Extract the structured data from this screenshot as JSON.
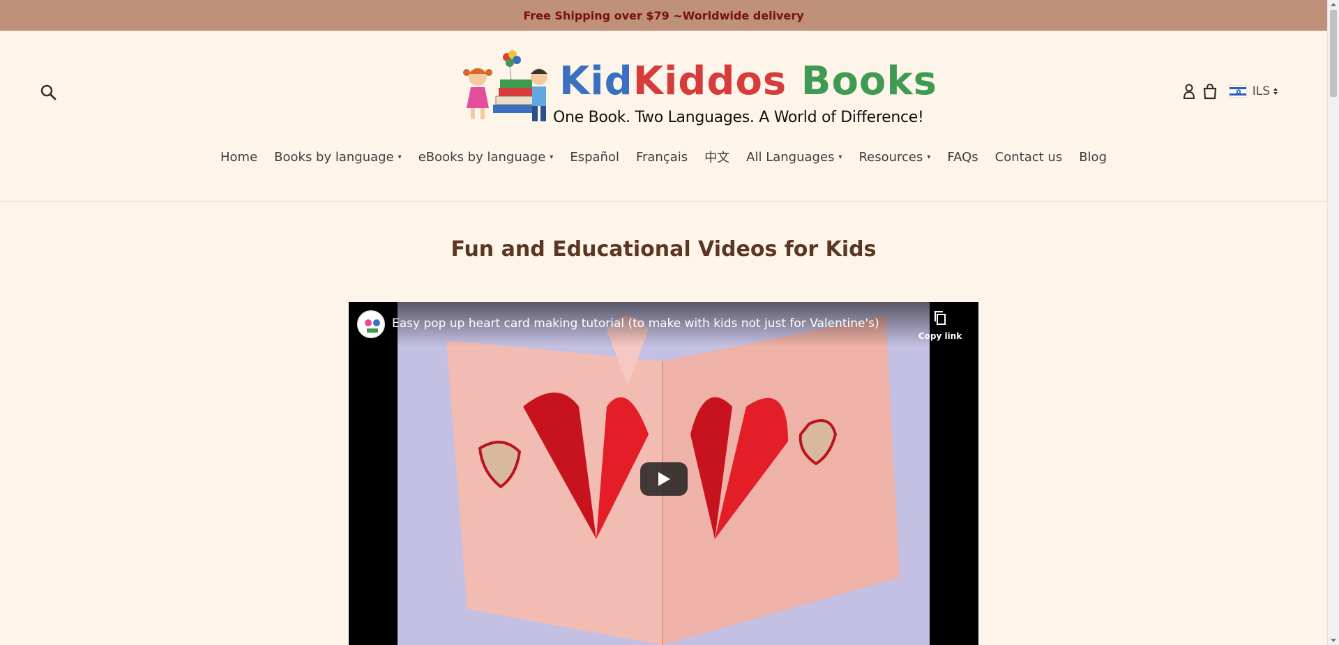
{
  "announcement": {
    "text": "Free Shipping over $79 ~Worldwide delivery"
  },
  "header": {
    "logo_word_kid": "Kid",
    "logo_word_kiddos": "Kiddos",
    "logo_word_books": "Books",
    "logo_tagline": "One Book. Two Languages. A World of Difference!",
    "currency": "ILS",
    "icons": [
      "search-icon",
      "account-icon",
      "cart-icon",
      "israel-flag-icon",
      "updown-caret-icon"
    ]
  },
  "nav": {
    "items": [
      {
        "label": "Home",
        "dropdown": false
      },
      {
        "label": "Books by language",
        "dropdown": true
      },
      {
        "label": "eBooks by language",
        "dropdown": true
      },
      {
        "label": "Español",
        "dropdown": false
      },
      {
        "label": "Français",
        "dropdown": false
      },
      {
        "label": "中文",
        "dropdown": false
      },
      {
        "label": "All Languages",
        "dropdown": true
      },
      {
        "label": "Resources",
        "dropdown": true
      },
      {
        "label": "FAQs",
        "dropdown": false
      },
      {
        "label": "Contact us",
        "dropdown": false
      },
      {
        "label": "Blog",
        "dropdown": false
      }
    ]
  },
  "main": {
    "page_title": "Fun and Educational Videos for Kids",
    "video": {
      "title": "Easy pop up heart card making tutorial (to make with kids not just for Valentine's)",
      "copy_link_label": "Copy link"
    }
  },
  "colors": {
    "announcement_bg": "#bf917a",
    "announcement_text": "#7a0f10",
    "page_bg": "#fdf5ea",
    "title_color": "#5a3623"
  }
}
